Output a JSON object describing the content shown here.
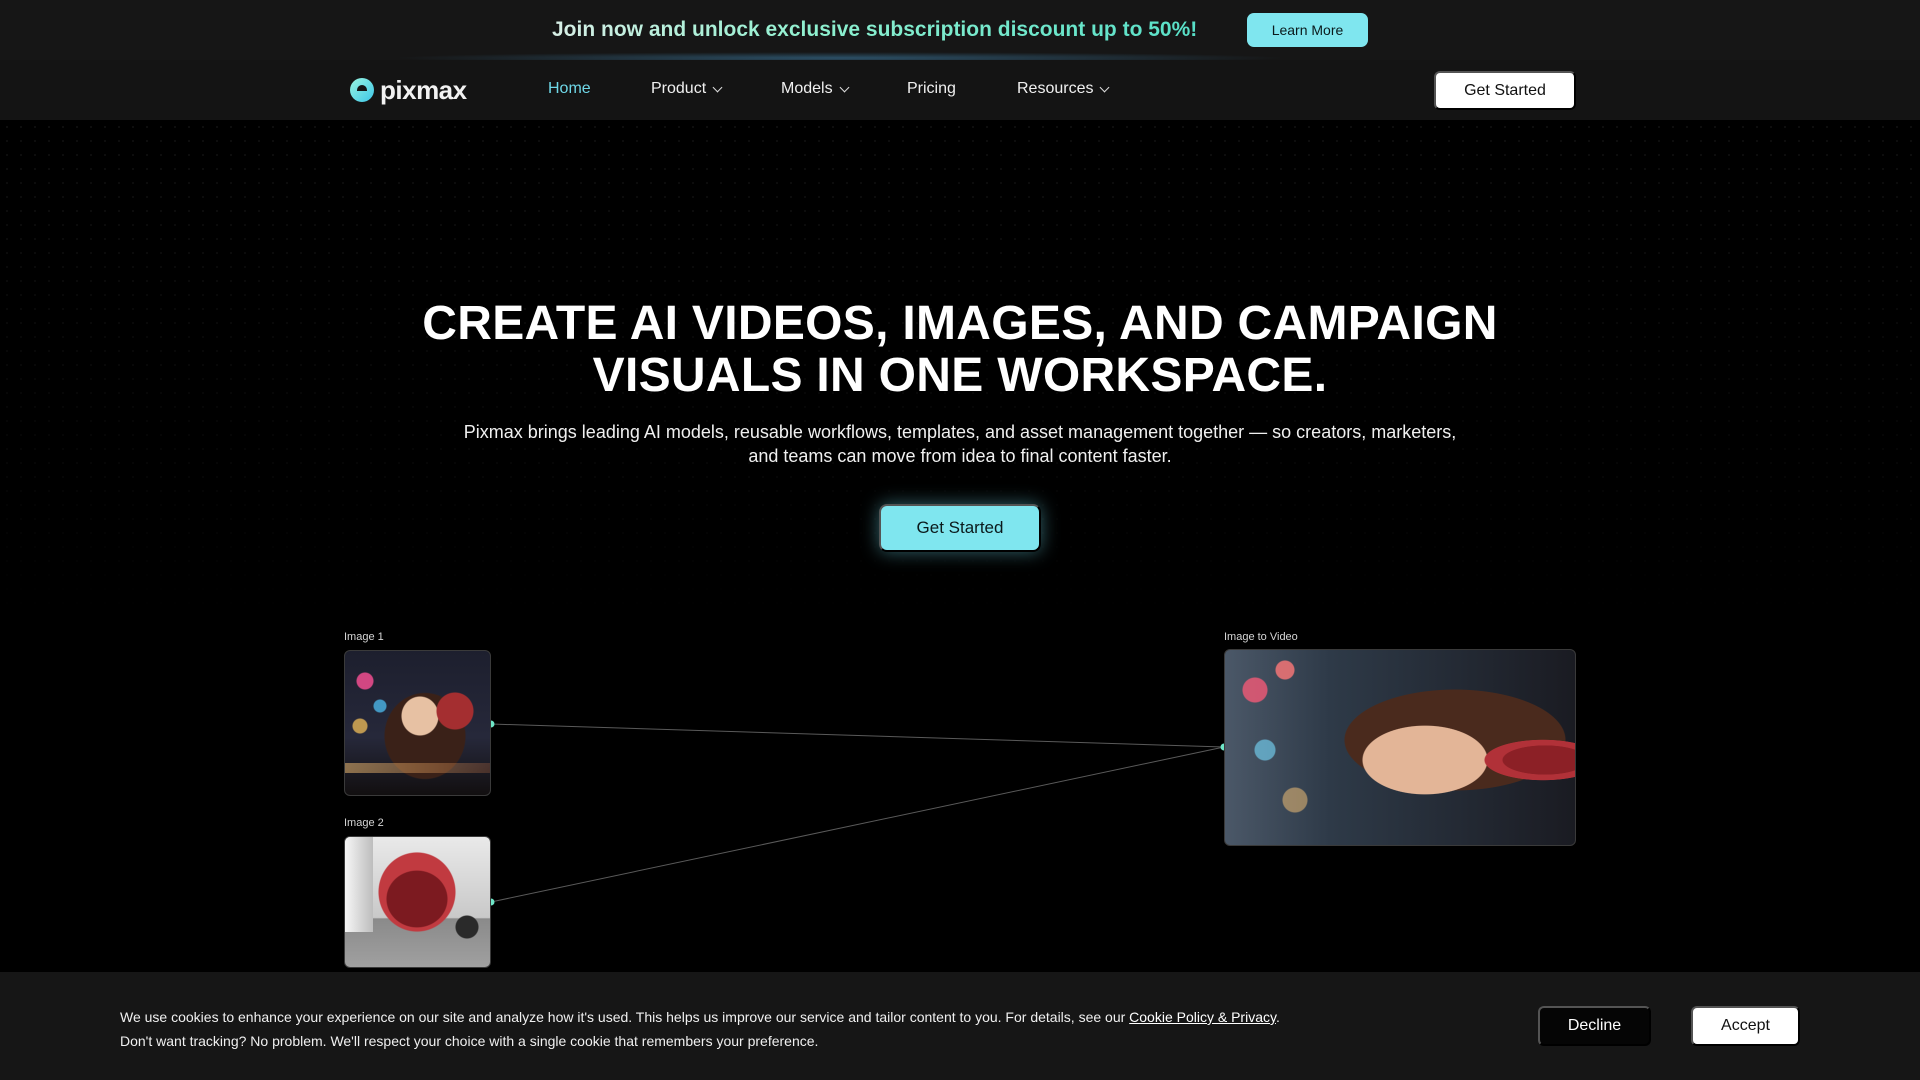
{
  "promo": {
    "text": "Join now and unlock exclusive subscription discount up to 50%!",
    "button_label": "Learn More"
  },
  "nav": {
    "logo_text": "pixmax",
    "items": [
      {
        "label": "Home",
        "active": true,
        "has_dropdown": false
      },
      {
        "label": "Product",
        "active": false,
        "has_dropdown": true
      },
      {
        "label": "Models",
        "active": false,
        "has_dropdown": true
      },
      {
        "label": "Pricing",
        "active": false,
        "has_dropdown": false
      },
      {
        "label": "Resources",
        "active": false,
        "has_dropdown": true
      }
    ],
    "cta_label": "Get Started"
  },
  "hero": {
    "title_line1": "CREATE AI VIDEOS, IMAGES, AND CAMPAIGN",
    "title_line2": "VISUALS IN ONE WORKSPACE.",
    "subtitle_line1": "Pixmax brings leading AI models, reusable workflows, templates, and asset management together — so creators, marketers,",
    "subtitle_line2": "and teams can move from idea to final content faster.",
    "cta_label": "Get Started"
  },
  "canvas": {
    "nodes": [
      {
        "label": "Image 1"
      },
      {
        "label": "Image 2"
      },
      {
        "label": "Image to Video"
      }
    ]
  },
  "cookie": {
    "text_before_link": "We use cookies to enhance your experience on our site and analyze how it's used. This helps us improve our service and tailor content to you. For details, see our ",
    "link_text": "Cookie Policy & Privacy",
    "text_after_link": ".",
    "line2": "Don't want tracking? No problem. We'll respect your choice with a single cookie that remembers your preference.",
    "decline_label": "Decline",
    "accept_label": "Accept"
  },
  "colors": {
    "accent": "#7fe6ef",
    "nav_active": "#6fd8e8",
    "promo_text": "#58e0c8",
    "background": "#000000"
  }
}
